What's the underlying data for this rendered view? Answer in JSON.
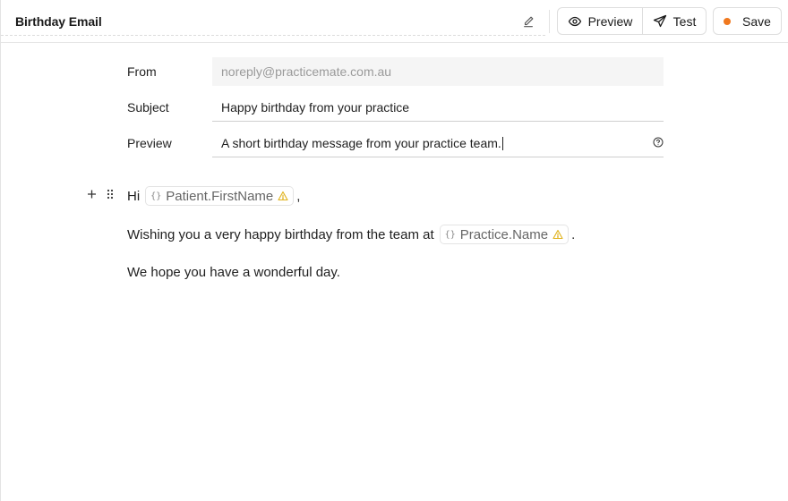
{
  "header": {
    "title": "Birthday Email",
    "preview_label": "Preview",
    "test_label": "Test",
    "save_label": "Save",
    "save_dot_color": "#f0781e"
  },
  "form": {
    "from_label": "From",
    "from_value": "noreply@practicemate.com.au",
    "subject_label": "Subject",
    "subject_value": "Happy birthday from your practice",
    "preview_label": "Preview",
    "preview_value": "A short birthday message from your practice team."
  },
  "editor": {
    "line1_prefix": "Hi",
    "line1_variable": "Patient.FirstName",
    "line1_suffix": ",",
    "line2_prefix": "Wishing you a very happy birthday from the team at",
    "line2_variable": "Practice.Name",
    "line2_suffix": ".",
    "line3": "We hope you have a wonderful day."
  },
  "icons": {
    "edit": "pencil-icon",
    "preview": "eye-icon",
    "test": "send-icon",
    "help": "question-circle-icon",
    "add_block": "plus-icon",
    "drag": "drag-handle-icon",
    "variable": "braces-icon",
    "warning": "warning-triangle-icon",
    "warning_color": "#e0b21b"
  }
}
